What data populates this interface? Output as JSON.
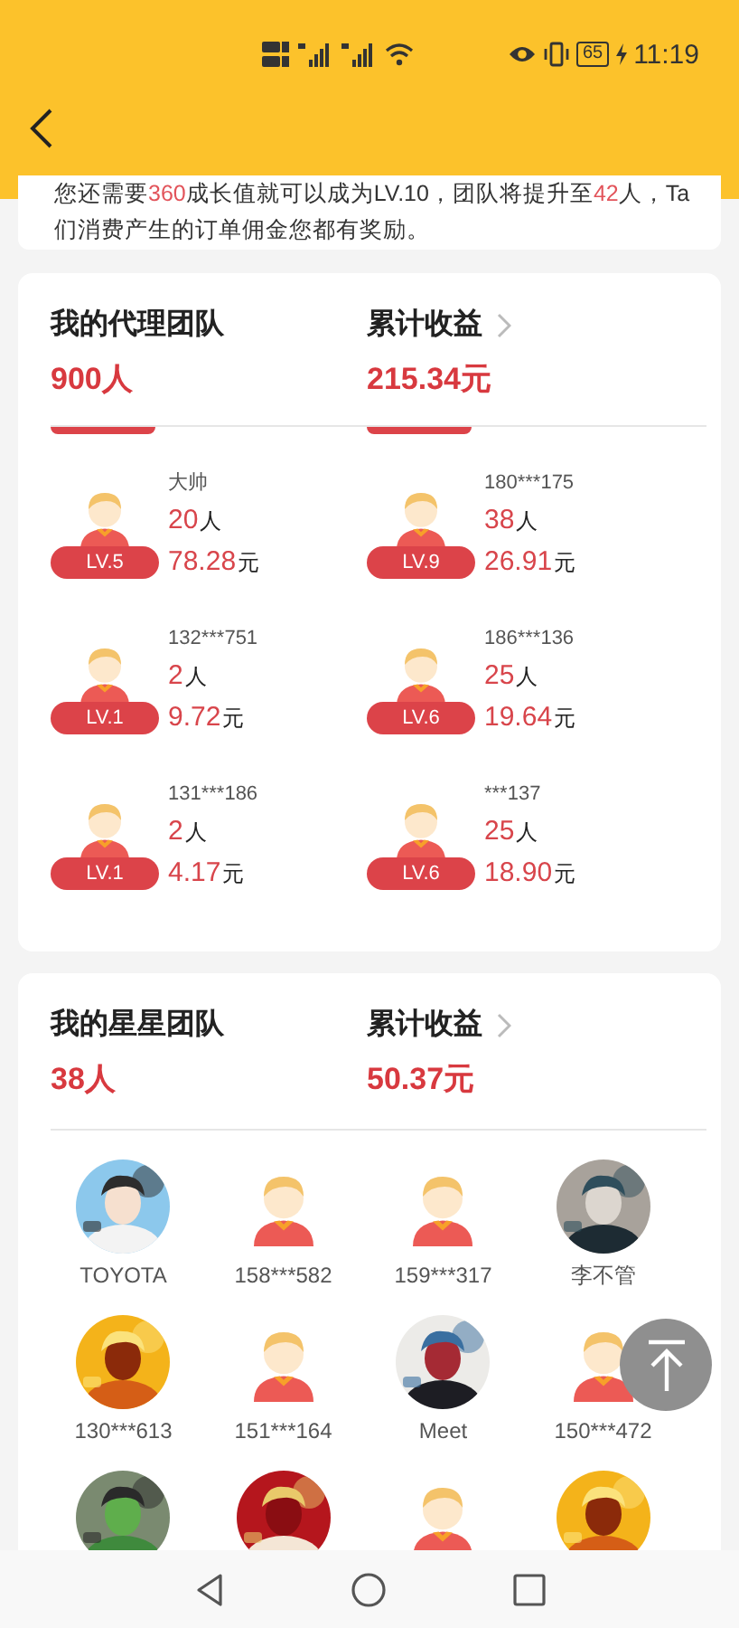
{
  "status_bar": {
    "battery": "65",
    "time": "11:19"
  },
  "notice": {
    "segments": [
      {
        "text": "您还需要",
        "highlight": false
      },
      {
        "text": "360",
        "highlight": true
      },
      {
        "text": "成长值就可以成为LV.10，团队将提升至",
        "highlight": false
      },
      {
        "text": "42",
        "highlight": true
      },
      {
        "text": "人，Ta们消费产生的订单佣金您都有奖励。",
        "highlight": false
      }
    ]
  },
  "agent_team": {
    "title": "我的代理团队",
    "count": "900人",
    "earnings_label": "累计收益",
    "earnings": "215.34元",
    "agents": [
      {
        "name": "大帅",
        "level": "LV.5",
        "members": "20",
        "people_unit": "人",
        "commission": "78.28",
        "money_unit": "元"
      },
      {
        "name": "180***175",
        "level": "LV.9",
        "members": "38",
        "people_unit": "人",
        "commission": "26.91",
        "money_unit": "元"
      },
      {
        "name": "132***751",
        "level": "LV.1",
        "members": "2",
        "people_unit": "人",
        "commission": "9.72",
        "money_unit": "元"
      },
      {
        "name": "186***136",
        "level": "LV.6",
        "members": "25",
        "people_unit": "人",
        "commission": "19.64",
        "money_unit": "元"
      },
      {
        "name": "131***186",
        "level": "LV.1",
        "members": "2",
        "people_unit": "人",
        "commission": "4.17",
        "money_unit": "元"
      },
      {
        "name": "***137",
        "level": "LV.6",
        "members": "25",
        "people_unit": "人",
        "commission": "18.90",
        "money_unit": "元"
      }
    ]
  },
  "star_team": {
    "title": "我的星星团队",
    "count": "38人",
    "earnings_label": "累计收益",
    "earnings": "50.37元",
    "members": [
      {
        "name": "TOYOTA",
        "kind": "picture"
      },
      {
        "name": "158***582",
        "kind": "default"
      },
      {
        "name": "159***317",
        "kind": "default"
      },
      {
        "name": "李不管",
        "kind": "picture"
      },
      {
        "name": "130***613",
        "kind": "picture"
      },
      {
        "name": "151***164",
        "kind": "default"
      },
      {
        "name": "Meet",
        "kind": "picture"
      },
      {
        "name": "150***472",
        "kind": "default"
      },
      {
        "kind": "picture"
      },
      {
        "kind": "picture"
      },
      {
        "kind": "default"
      },
      {
        "kind": "picture"
      }
    ]
  }
}
